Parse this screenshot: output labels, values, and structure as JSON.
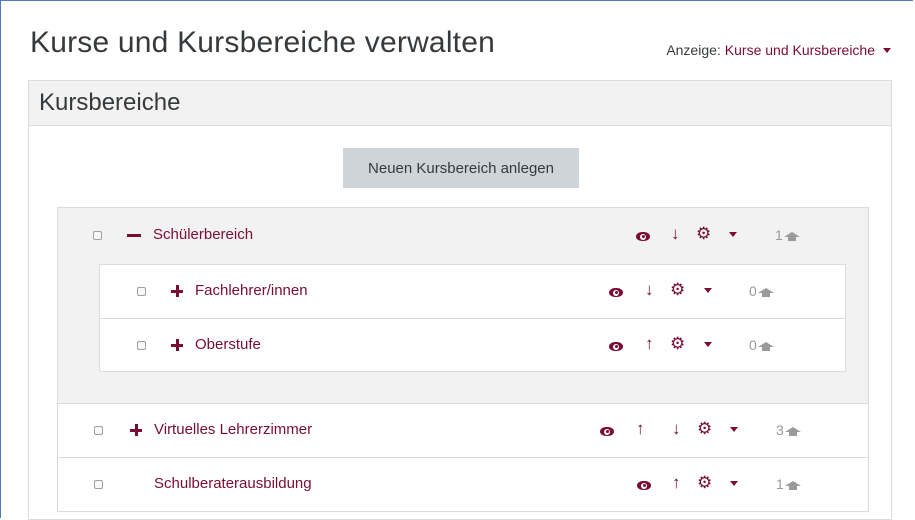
{
  "page": {
    "title": "Kurse und Kursbereiche verwalten",
    "view_label": "Anzeige:",
    "view_value": "Kurse und Kursbereiche"
  },
  "panel": {
    "title": "Kursbereiche",
    "new_button": "Neuen Kursbereich anlegen"
  },
  "categories": [
    {
      "name": "Schülerbereich",
      "toggle": "collapse",
      "count": "1"
    },
    {
      "name": "Fachlehrer/innen",
      "toggle": "expand",
      "count": "0"
    },
    {
      "name": "Oberstufe",
      "toggle": "expand",
      "count": "0"
    },
    {
      "name": "Virtuelles Lehrerzimmer",
      "toggle": "expand",
      "count": "3"
    },
    {
      "name": "Schulberaterausbildung",
      "toggle": "none",
      "count": "1"
    }
  ],
  "icons": {
    "visibility": "eye-icon",
    "move_up": "arrow-up-icon",
    "move_down": "arrow-down-icon",
    "actions": "gear-icon",
    "courses": "graduation-cap-icon"
  },
  "colors": {
    "accent": "#7a0d32",
    "button_bg": "#ced4da",
    "panel_head_bg": "#f2f2f2",
    "muted": "#9a9a9a"
  }
}
